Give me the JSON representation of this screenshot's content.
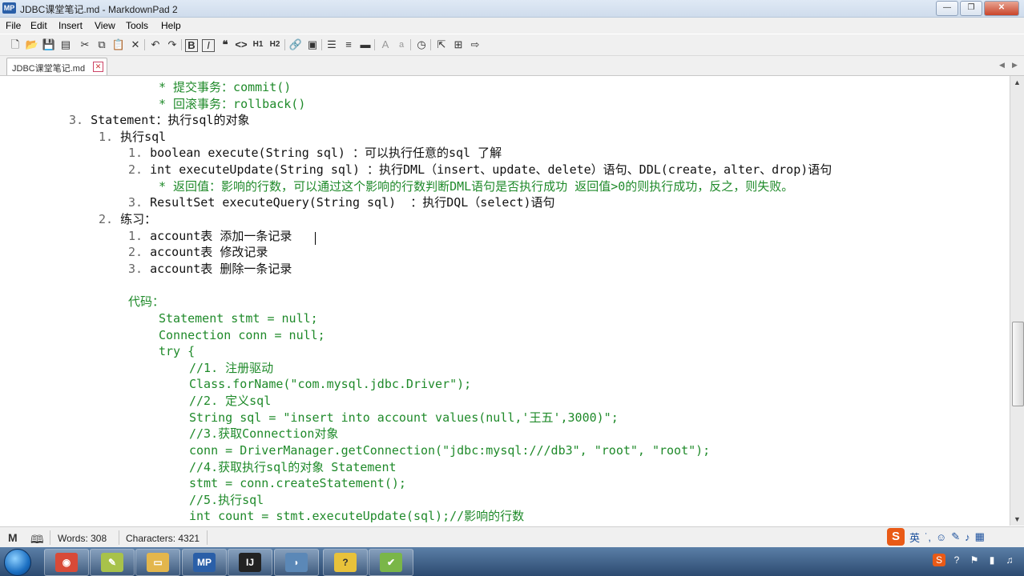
{
  "window": {
    "app_icon": "MP",
    "title": "JDBC课堂笔记.md - MarkdownPad 2",
    "minimize": "—",
    "maximize": "❐",
    "close": "✕"
  },
  "menu": [
    "File",
    "Edit",
    "Insert",
    "View",
    "Tools",
    "Help"
  ],
  "toolbar": {
    "icons": [
      "new-file-icon",
      "open-folder-icon",
      "save-icon",
      "save-all-icon",
      "cut-icon",
      "copy-icon",
      "paste-icon",
      "delete-icon",
      "undo-icon",
      "redo-icon",
      "bold-icon",
      "italic-icon",
      "quote-icon",
      "code-icon",
      "h1-icon",
      "h2-icon",
      "link-icon",
      "image-icon",
      "unordered-list-icon",
      "ordered-list-icon",
      "horizontal-rule-icon",
      "font-larger-icon",
      "font-smaller-icon",
      "timestamp-icon",
      "preview-icon",
      "split-view-icon",
      "export-icon"
    ],
    "h1": "H1",
    "h2": "H2"
  },
  "tab": {
    "label": "JDBC课堂笔记.md",
    "close": "✕"
  },
  "editor": {
    "lines": [
      {
        "num": "",
        "text": "* 提交事务：commit()",
        "color": "green"
      },
      {
        "num": "",
        "text": "* 回滚事务：rollback()",
        "color": "green"
      },
      {
        "num": "3.",
        "text": "Statement：执行sql的对象",
        "color": "normal"
      },
      {
        "num": "1.",
        "text": "执行sql",
        "color": "normal"
      },
      {
        "num": "1.",
        "text": "boolean execute(String sql) ：可以执行任意的sql 了解",
        "color": "normal"
      },
      {
        "num": "2.",
        "text": "int executeUpdate(String sql) ：执行DML（insert、update、delete）语句、DDL(create，alter、drop)语句",
        "color": "normal"
      },
      {
        "num": "",
        "text": "* 返回值：影响的行数，可以通过这个影响的行数判断DML语句是否执行成功 返回值>0的则执行成功，反之，则失败。",
        "color": "green"
      },
      {
        "num": "3.",
        "text": "ResultSet executeQuery(String sql)  ：执行DQL（select)语句",
        "color": "normal"
      },
      {
        "num": "2.",
        "text": "练习：",
        "color": "normal"
      },
      {
        "num": "1.",
        "text": "account表 添加一条记录",
        "color": "normal"
      },
      {
        "num": "2.",
        "text": "account表 修改记录",
        "color": "normal"
      },
      {
        "num": "3.",
        "text": "account表 删除一条记录",
        "color": "normal"
      },
      {
        "num": "",
        "text": "",
        "color": "normal"
      },
      {
        "num": "",
        "text": "代码：",
        "color": "green"
      },
      {
        "num": "",
        "text": "Statement stmt = null;",
        "color": "green"
      },
      {
        "num": "",
        "text": "Connection conn = null;",
        "color": "green"
      },
      {
        "num": "",
        "text": "try {",
        "color": "green"
      },
      {
        "num": "",
        "text": "//1. 注册驱动",
        "color": "green"
      },
      {
        "num": "",
        "text": "Class.forName(\"com.mysql.jdbc.Driver\");",
        "color": "green"
      },
      {
        "num": "",
        "text": "//2. 定义sql",
        "color": "green"
      },
      {
        "num": "",
        "text": "String sql = \"insert into account values(null,'王五',3000)\";",
        "color": "green"
      },
      {
        "num": "",
        "text": "//3.获取Connection对象",
        "color": "green"
      },
      {
        "num": "",
        "text": "conn = DriverManager.getConnection(\"jdbc:mysql:///db3\", \"root\", \"root\");",
        "color": "green"
      },
      {
        "num": "",
        "text": "//4.获取执行sql的对象 Statement",
        "color": "green"
      },
      {
        "num": "",
        "text": "stmt = conn.createStatement();",
        "color": "green"
      },
      {
        "num": "",
        "text": "//5.执行sql",
        "color": "green"
      },
      {
        "num": "",
        "text": "int count = stmt.executeUpdate(sql);//影响的行数",
        "color": "green"
      }
    ]
  },
  "status": {
    "words_label": "Words: 308",
    "chars_label": "Characters: 4321"
  },
  "ime": {
    "logo": "S",
    "lang": "英",
    "punct": "˙,",
    "emoji": "☺",
    "skin": "✎",
    "mic": "♪",
    "grid": "▦"
  },
  "taskbar": {
    "apps": [
      {
        "name": "chrome",
        "glyph": "◉",
        "color": "#d84a38"
      },
      {
        "name": "notepad",
        "glyph": "✎",
        "color": "#a8c24a"
      },
      {
        "name": "explorer",
        "glyph": "▭",
        "color": "#e3b64c"
      },
      {
        "name": "markdownpad",
        "glyph": "MP",
        "color": "#2a5fa8"
      },
      {
        "name": "intellij",
        "glyph": "IJ",
        "color": "#222222"
      },
      {
        "name": "mysql",
        "glyph": "◗",
        "color": "#5b88b7"
      },
      {
        "name": "help",
        "glyph": "?",
        "color": "#e8c23a"
      },
      {
        "name": "chart-tool",
        "glyph": "✔",
        "color": "#7ab648"
      }
    ]
  },
  "colors": {
    "code_green": "#1f8a2a",
    "text": "#111111",
    "ime_orange": "#e95a16"
  }
}
